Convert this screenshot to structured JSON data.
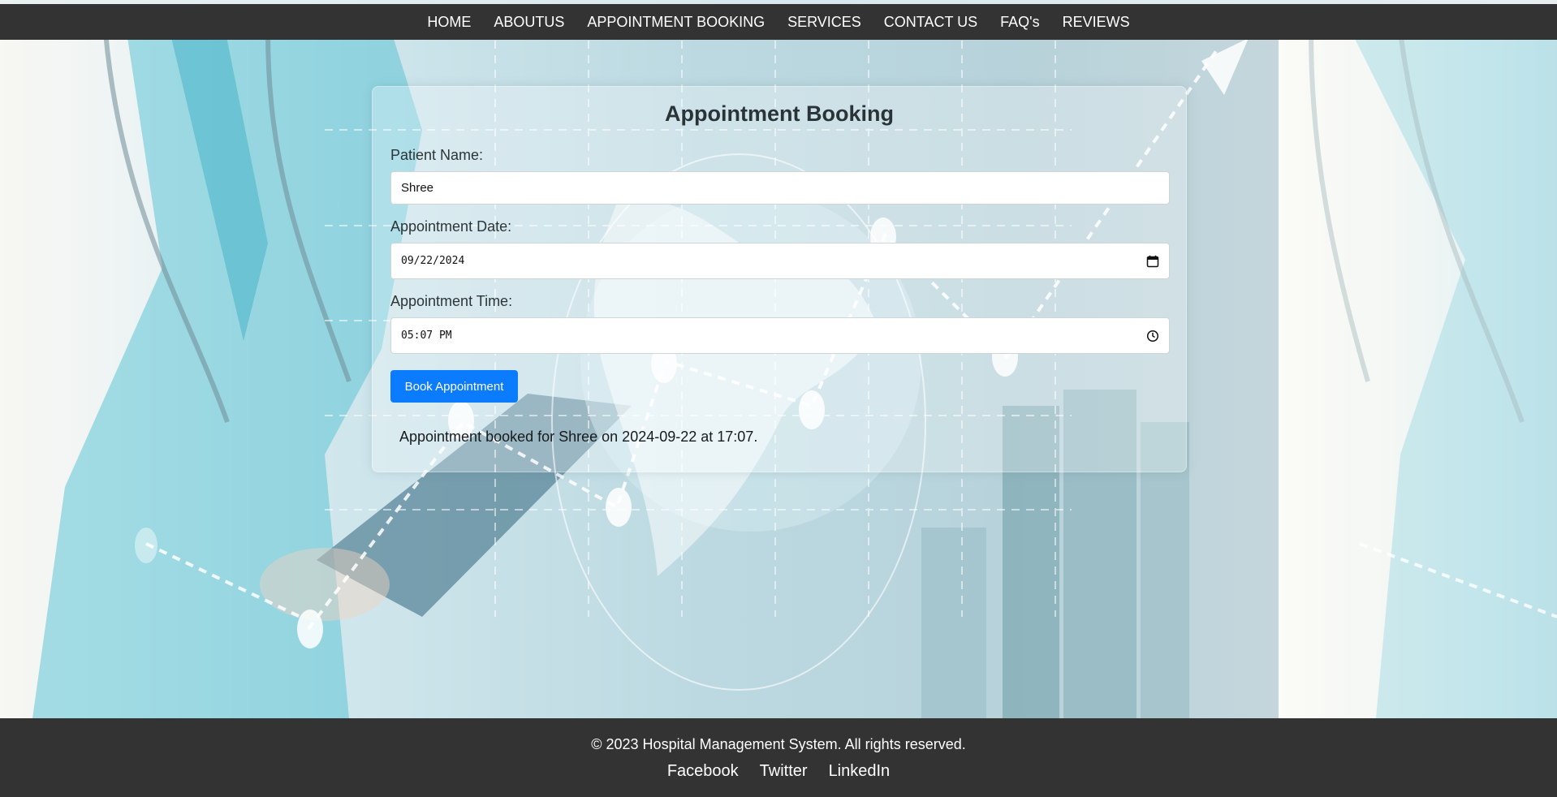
{
  "nav": {
    "items": [
      "HOME",
      "ABOUTUS",
      "APPOINTMENT BOOKING",
      "SERVICES",
      "CONTACT US",
      "FAQ's",
      "REVIEWS"
    ]
  },
  "form": {
    "title": "Appointment Booking",
    "patient_name": {
      "label": "Patient Name:",
      "value": "Shree"
    },
    "date": {
      "label": "Appointment Date:",
      "value": "09/22/2024",
      "icon": "calendar-icon"
    },
    "time": {
      "label": "Appointment Time:",
      "value": "05:07 PM",
      "icon": "clock-icon"
    },
    "submit_label": "Book Appointment",
    "confirmation": "Appointment booked for Shree on 2024-09-22 at 17:07."
  },
  "footer": {
    "copyright": "© 2023 Hospital Management System. All rights reserved.",
    "links": [
      "Facebook",
      "Twitter",
      "LinkedIn"
    ]
  },
  "colors": {
    "nav_bg": "#333333",
    "button": "#0b7bff",
    "footer_bg": "#333333"
  }
}
